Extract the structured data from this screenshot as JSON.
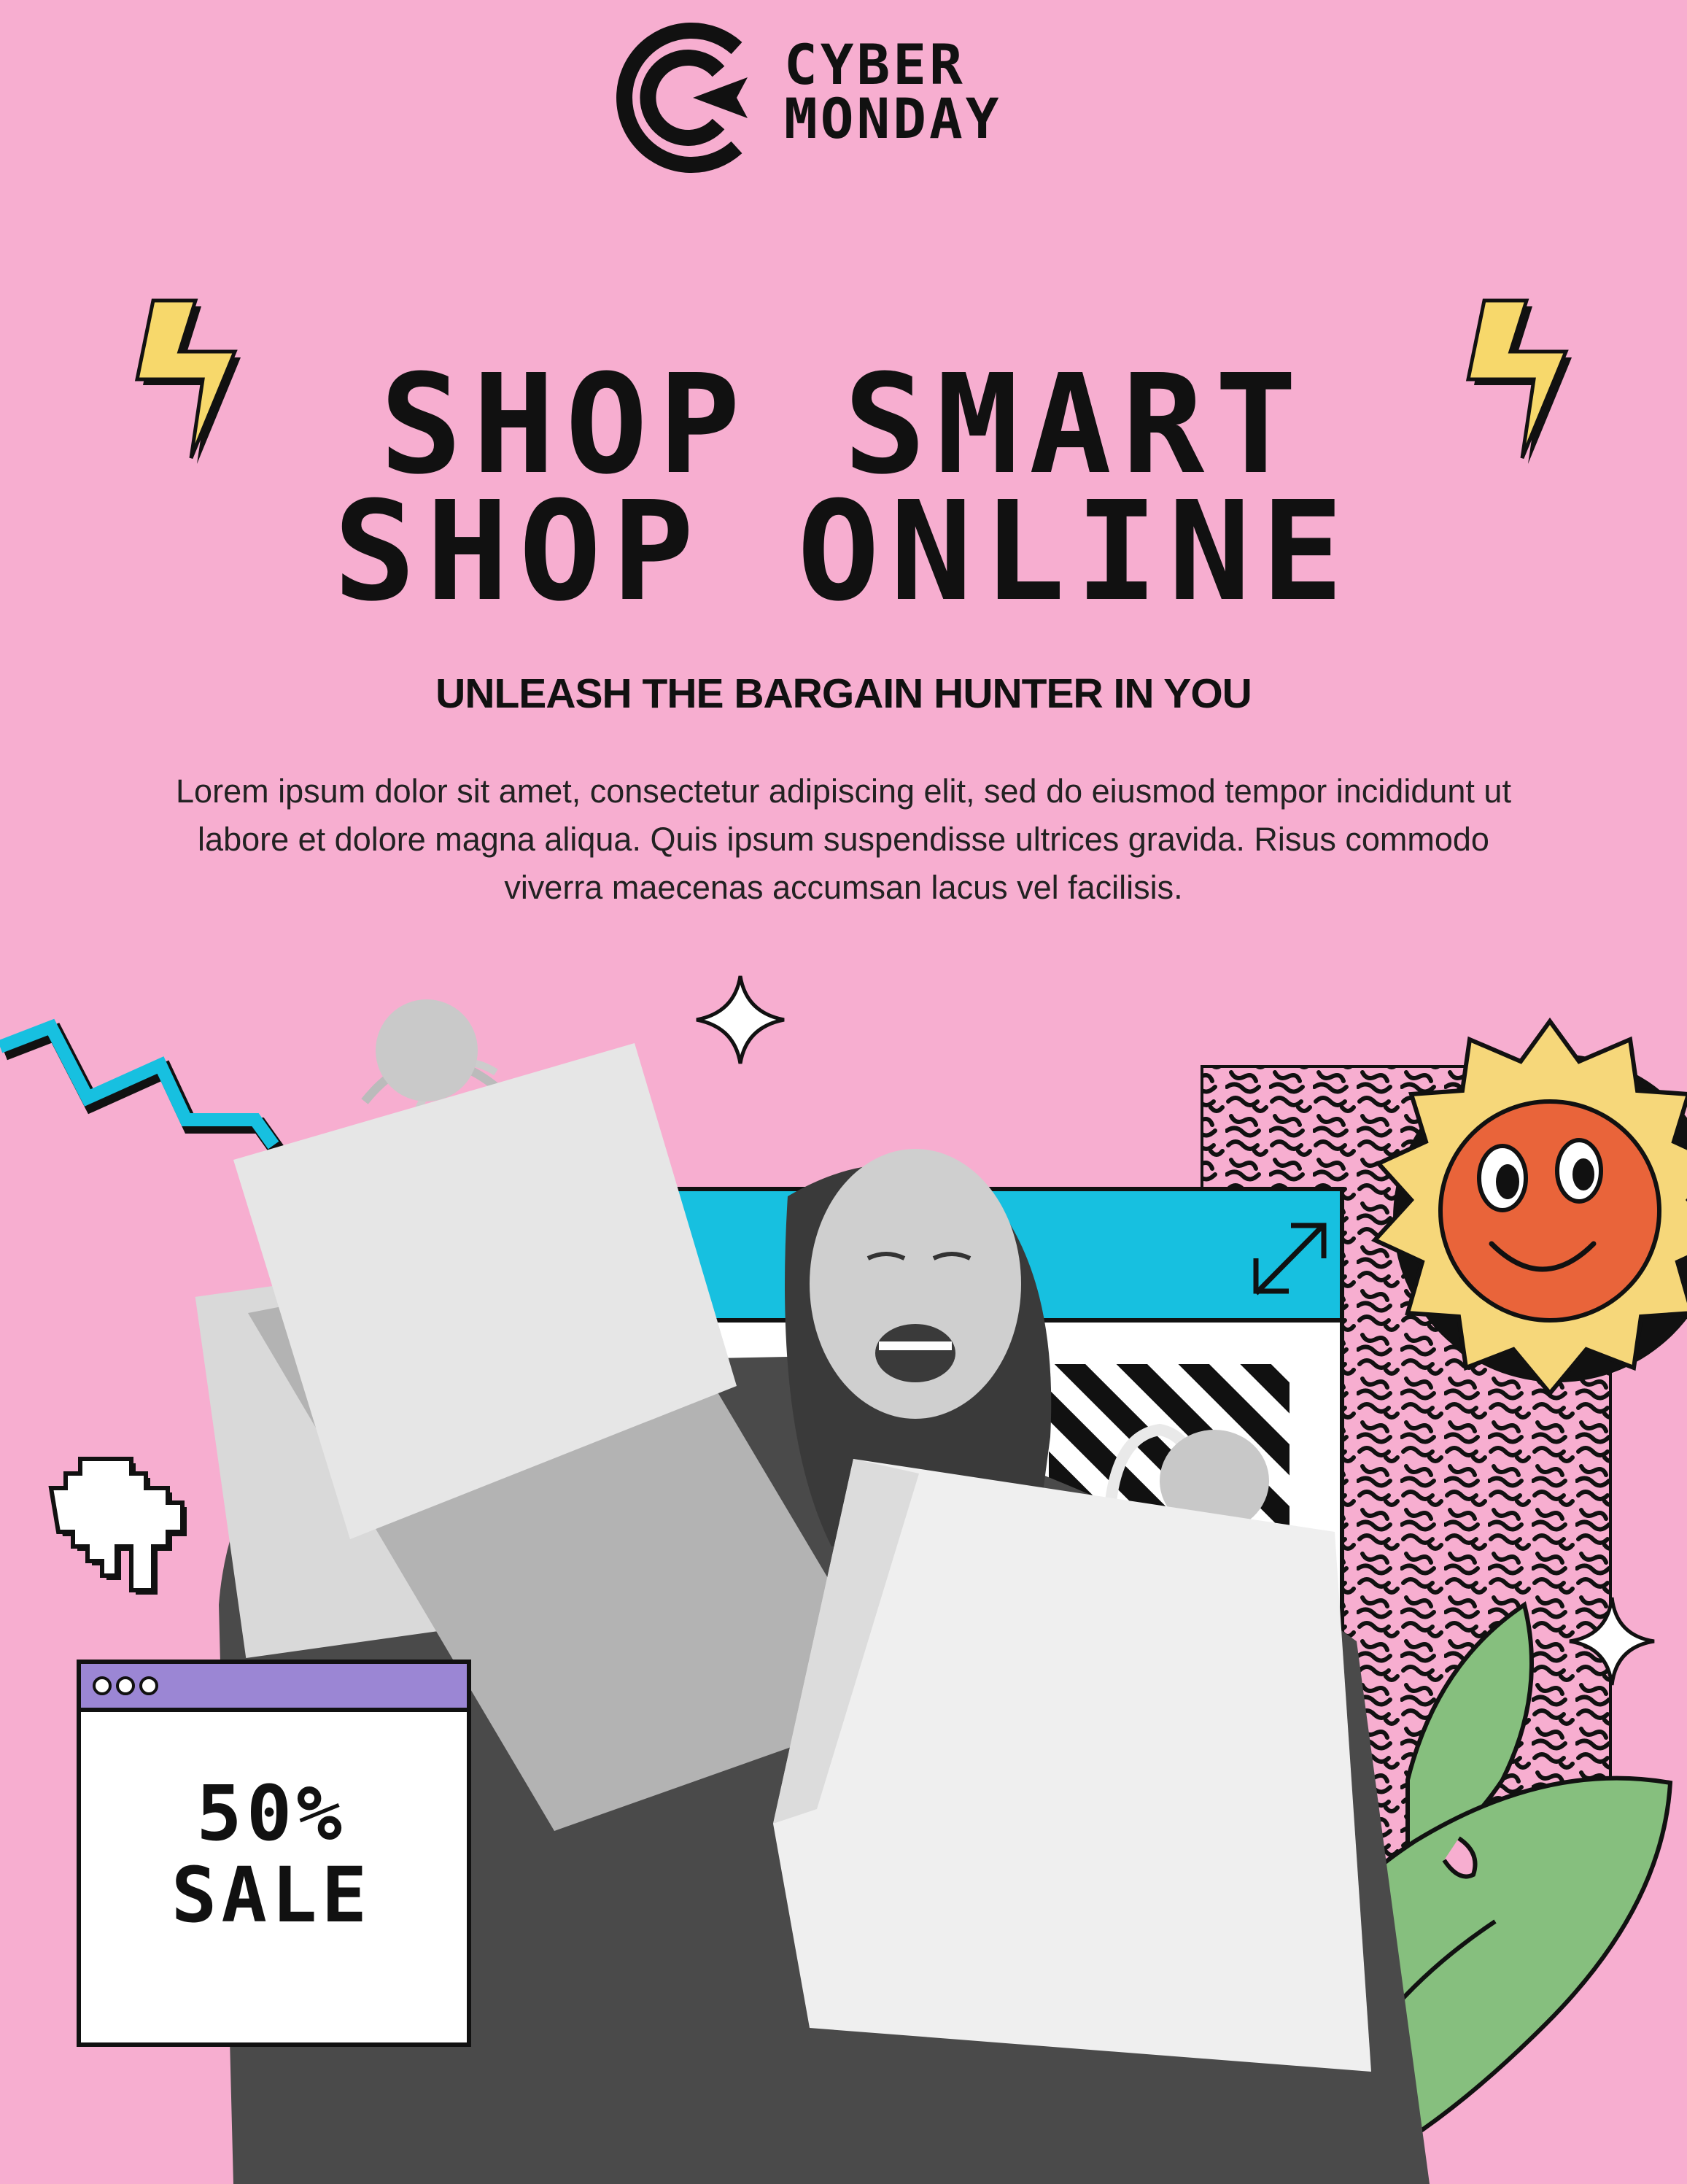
{
  "brand": {
    "line1": "CYBER",
    "line2": "MONDAY"
  },
  "headline": {
    "line1": "SHOP SMART",
    "line2": "SHOP ONLINE"
  },
  "subheading": "UNLEASH THE BARGAIN HUNTER IN YOU",
  "body": "Lorem ipsum dolor sit amet, consectetur adipiscing elit, sed do eiusmod tempor incididunt ut labore et dolore magna aliqua. Quis ipsum suspendisse ultrices gravida. Risus commodo viverra maecenas accumsan lacus vel facilisis.",
  "sale_badge": {
    "line1": "50%",
    "line2": "SALE"
  },
  "colors": {
    "background": "#F7AED0",
    "cyan": "#17C0E0",
    "purple": "#9B86D4",
    "sun_yellow": "#F6D77A",
    "sun_face": "#E9643A",
    "leaf_green": "#86BF7E",
    "bolt_yellow": "#F7D86B"
  }
}
